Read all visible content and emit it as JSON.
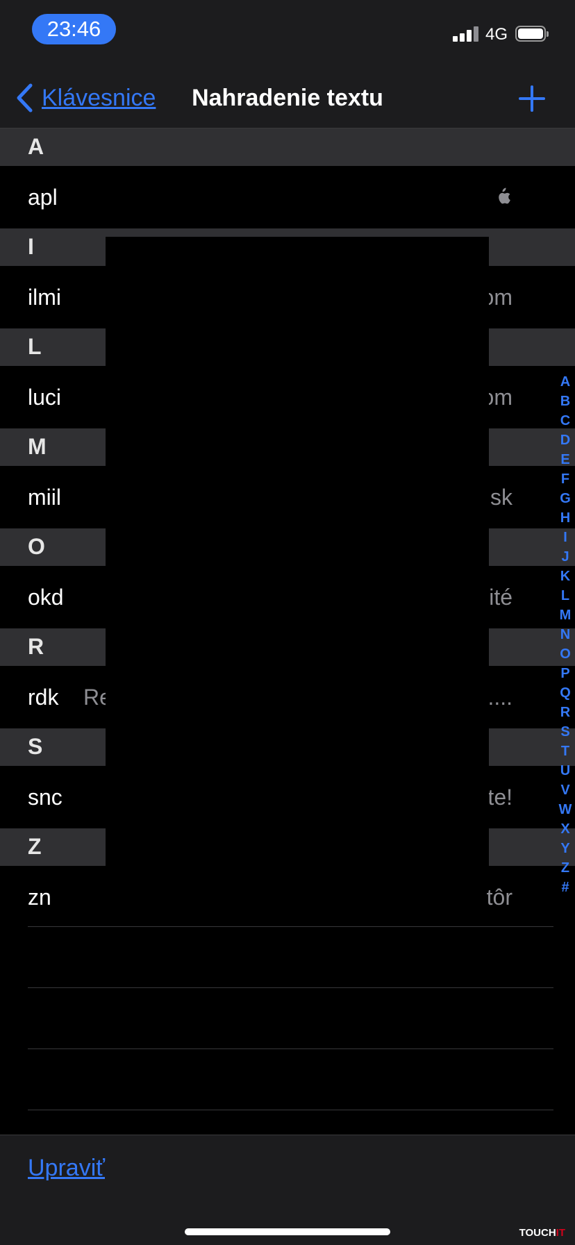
{
  "status_bar": {
    "time": "23:46",
    "network": "4G",
    "accent_color": "#3478f6"
  },
  "nav": {
    "back_label": "Klávesnice",
    "title": "Nahradenie textu",
    "add_icon": "plus-icon"
  },
  "sections": [
    {
      "letter": "A",
      "rows": [
        {
          "shortcut": "apl",
          "phrase_icon": "apple-logo-icon"
        }
      ]
    },
    {
      "letter": "I",
      "rows": [
        {
          "shortcut": "ilmi",
          "phrase": "om"
        }
      ]
    },
    {
      "letter": "L",
      "rows": [
        {
          "shortcut": "luci",
          "phrase": "om"
        }
      ]
    },
    {
      "letter": "M",
      "rows": [
        {
          "shortcut": "miil",
          "phrase": "sk"
        }
      ]
    },
    {
      "letter": "O",
      "rows": [
        {
          "shortcut": "okd",
          "phrase": "ité"
        }
      ]
    },
    {
      "letter": "R",
      "rows": [
        {
          "shortcut": "rdk",
          "phrase_left": "Re",
          "phrase": "...."
        }
      ]
    },
    {
      "letter": "S",
      "rows": [
        {
          "shortcut": "snc",
          "phrase": "te!"
        }
      ]
    },
    {
      "letter": "Z",
      "rows": [
        {
          "shortcut": "zn",
          "phrase": "tôr"
        }
      ]
    }
  ],
  "index_letters": [
    "A",
    "B",
    "C",
    "D",
    "E",
    "F",
    "G",
    "H",
    "I",
    "J",
    "K",
    "L",
    "M",
    "N",
    "O",
    "P",
    "Q",
    "R",
    "S",
    "T",
    "U",
    "V",
    "W",
    "X",
    "Y",
    "Z",
    "#"
  ],
  "toolbar": {
    "edit_label": "Upraviť"
  },
  "watermark": {
    "text_main": "TOUCH",
    "text_accent": "IT"
  }
}
